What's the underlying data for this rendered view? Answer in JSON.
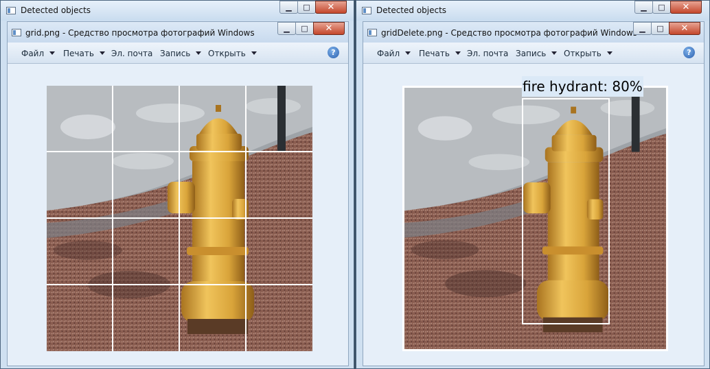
{
  "left": {
    "outer_title": "Detected objects",
    "inner_title": "grid.png - Средство просмотра фотографий Windows"
  },
  "right": {
    "outer_title": "Detected objects",
    "inner_title": "gridDelete.png - Средство просмотра фотографий Windows",
    "detection_label": "fire hydrant: 80%"
  },
  "menu": {
    "file": "Файл",
    "print": "Печать",
    "email": "Эл. почта",
    "burn": "Запись",
    "open": "Открыть"
  },
  "caption_buttons": {
    "minimize": "▁",
    "maximize": "□",
    "close": "✕"
  },
  "help": "?",
  "colors": {
    "hydrant": "#d9a43a",
    "ground": "#8a5d50",
    "pavement": "#9aa0a6",
    "grid": "#ffffff"
  }
}
